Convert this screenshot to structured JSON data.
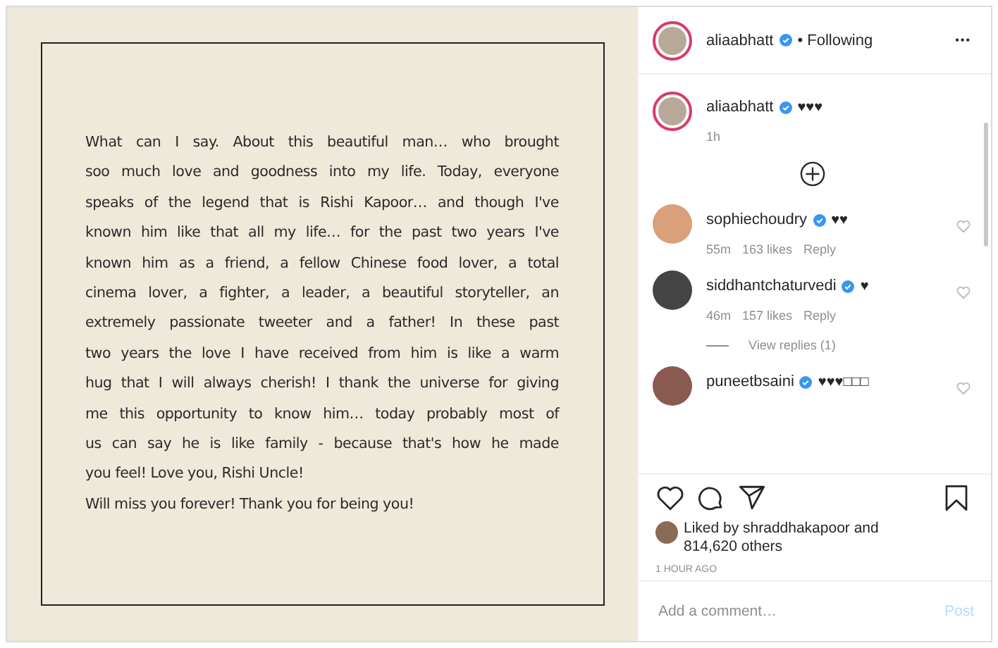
{
  "post": {
    "paragraphs": [
      [
        "What can I say. About this beautiful man… who brought",
        "soo much love and goodness into my life. Today, everyone",
        "speaks of the legend that is Rishi Kapoor… and though I've",
        "known him like that all my life… for the past two years I've",
        "known him as a friend, a fellow Chinese food lover, a total",
        "cinema lover, a fighter, a leader, a beautiful storyteller, an",
        "extremely passionate tweeter and a father! In these past",
        "two years the love I have received from him is like a warm",
        "hug that I will always cherish! I thank the universe for giving",
        "me this opportunity to know him… today probably most of",
        "us can say he is like family - because that's how he made",
        "you feel! Love you, Rishi Uncle!"
      ],
      [
        "Will miss you forever! Thank you for being you!"
      ]
    ]
  },
  "header": {
    "username": "aliaabhatt",
    "verified": true,
    "follow_state": "• Following",
    "menu": "•••"
  },
  "caption": {
    "username": "aliaabhatt",
    "verified": true,
    "text": "♥♥♥",
    "time": "1h"
  },
  "comments": [
    {
      "username": "sophiechoudry",
      "verified": true,
      "text": "♥♥",
      "time": "55m",
      "likes": "163 likes",
      "reply": "Reply",
      "color": "#d9a07a"
    },
    {
      "username": "siddhantchaturvedi",
      "verified": true,
      "text": "♥",
      "time": "46m",
      "likes": "157 likes",
      "reply": "Reply",
      "color": "#444444",
      "view_replies": "View replies (1)"
    },
    {
      "username": "puneetbsaini",
      "verified": true,
      "text": "♥♥♥□□□",
      "color": "#8a5a50"
    }
  ],
  "liked_by": {
    "prefix": "Liked by ",
    "name": "shraddhakapoor",
    "suffix": " and",
    "others": "814,620 others"
  },
  "timestamp": "1 HOUR AGO",
  "add_comment": {
    "placeholder": "Add a comment…",
    "post": "Post"
  }
}
